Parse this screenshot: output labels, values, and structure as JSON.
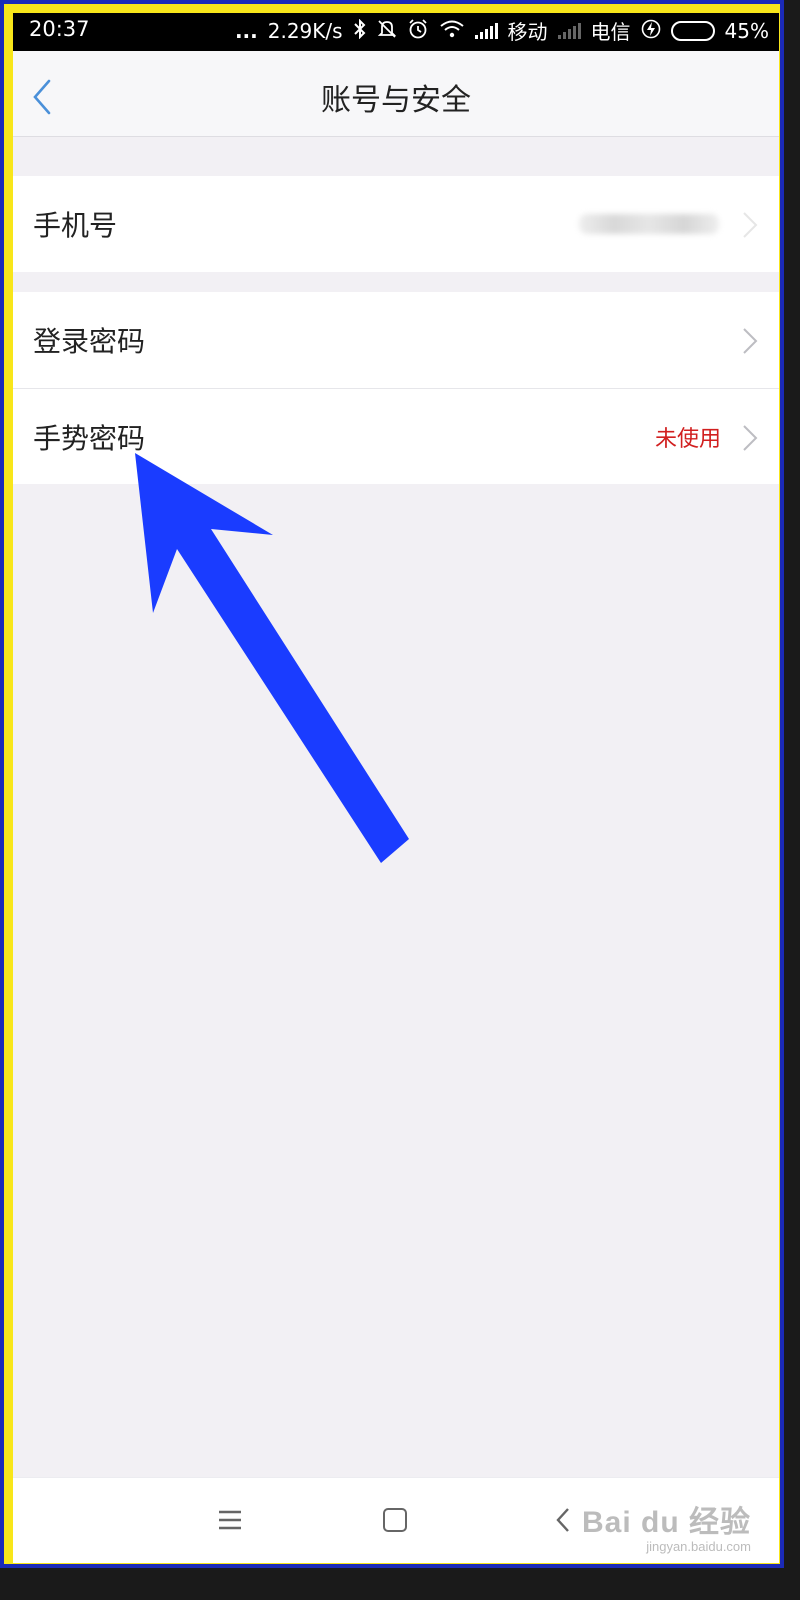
{
  "status_bar": {
    "time": "20:37",
    "dots": "...",
    "speed": "2.29K/s",
    "carrier1": "移动",
    "carrier2": "电信",
    "battery_percent": "45%",
    "battery_level": 0.45,
    "battery_color": "#3ad53a",
    "icons": [
      "bluetooth-icon",
      "mute-bell-icon",
      "alarm-icon",
      "wifi-icon",
      "signal-icon",
      "charging-icon"
    ]
  },
  "header": {
    "title": "账号与安全",
    "back_icon": "chevron-left-icon",
    "accent": "#4a90d9"
  },
  "groups": [
    {
      "rows": [
        {
          "label": "手机号",
          "value": ""
        }
      ]
    },
    {
      "rows": [
        {
          "label": "登录密码",
          "value": ""
        },
        {
          "label": "手势密码",
          "value": "未使用",
          "value_color": "#d11f1f"
        }
      ]
    }
  ],
  "annotation": {
    "arrow_color": "#1a3cff",
    "arrow_icon": "pointer-arrow-icon"
  },
  "bottom_nav": {
    "icons": [
      "menu-icon",
      "home-icon",
      "back-icon"
    ]
  },
  "watermark": {
    "main": "Bai du 经验",
    "sub": "jingyan.baidu.com"
  },
  "frame_colors": {
    "outer_border": "#1b2ab8",
    "inner_border": "#f8e61a",
    "background": "#f2f0f4"
  }
}
